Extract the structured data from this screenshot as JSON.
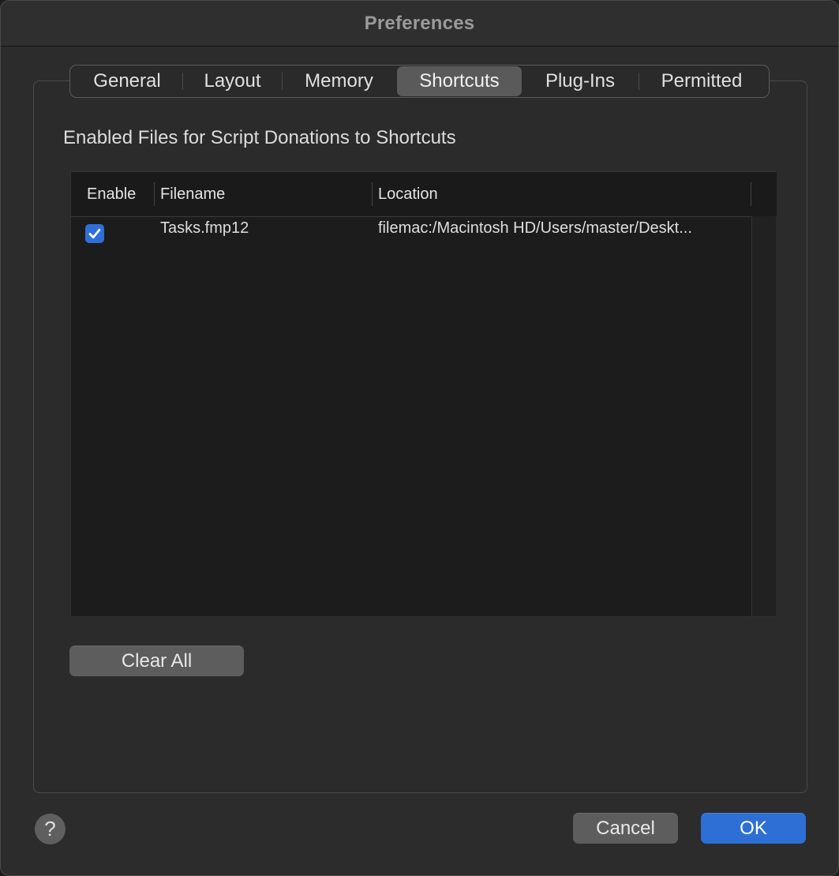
{
  "window": {
    "title": "Preferences"
  },
  "tabs": [
    {
      "label": "General",
      "selected": false
    },
    {
      "label": "Layout",
      "selected": false
    },
    {
      "label": "Memory",
      "selected": false
    },
    {
      "label": "Shortcuts",
      "selected": true
    },
    {
      "label": "Plug-Ins",
      "selected": false
    },
    {
      "label": "Permitted",
      "selected": false
    }
  ],
  "section": {
    "label": "Enabled Files for Script Donations to Shortcuts"
  },
  "table": {
    "columns": [
      "Enable",
      "Filename",
      "Location"
    ],
    "rows": [
      {
        "enabled": true,
        "filename": "Tasks.fmp12",
        "location": "filemac:/Macintosh HD/Users/master/Deskt..."
      }
    ]
  },
  "buttons": {
    "clear_all": "Clear All",
    "cancel": "Cancel",
    "ok": "OK",
    "help": "?"
  },
  "colors": {
    "accent": "#2e6fd6",
    "window_bg": "#2c2c2c",
    "selected_tab": "#5a5a5a"
  },
  "icons": {
    "checkbox": "checkmark-icon",
    "help": "question-mark-icon"
  }
}
